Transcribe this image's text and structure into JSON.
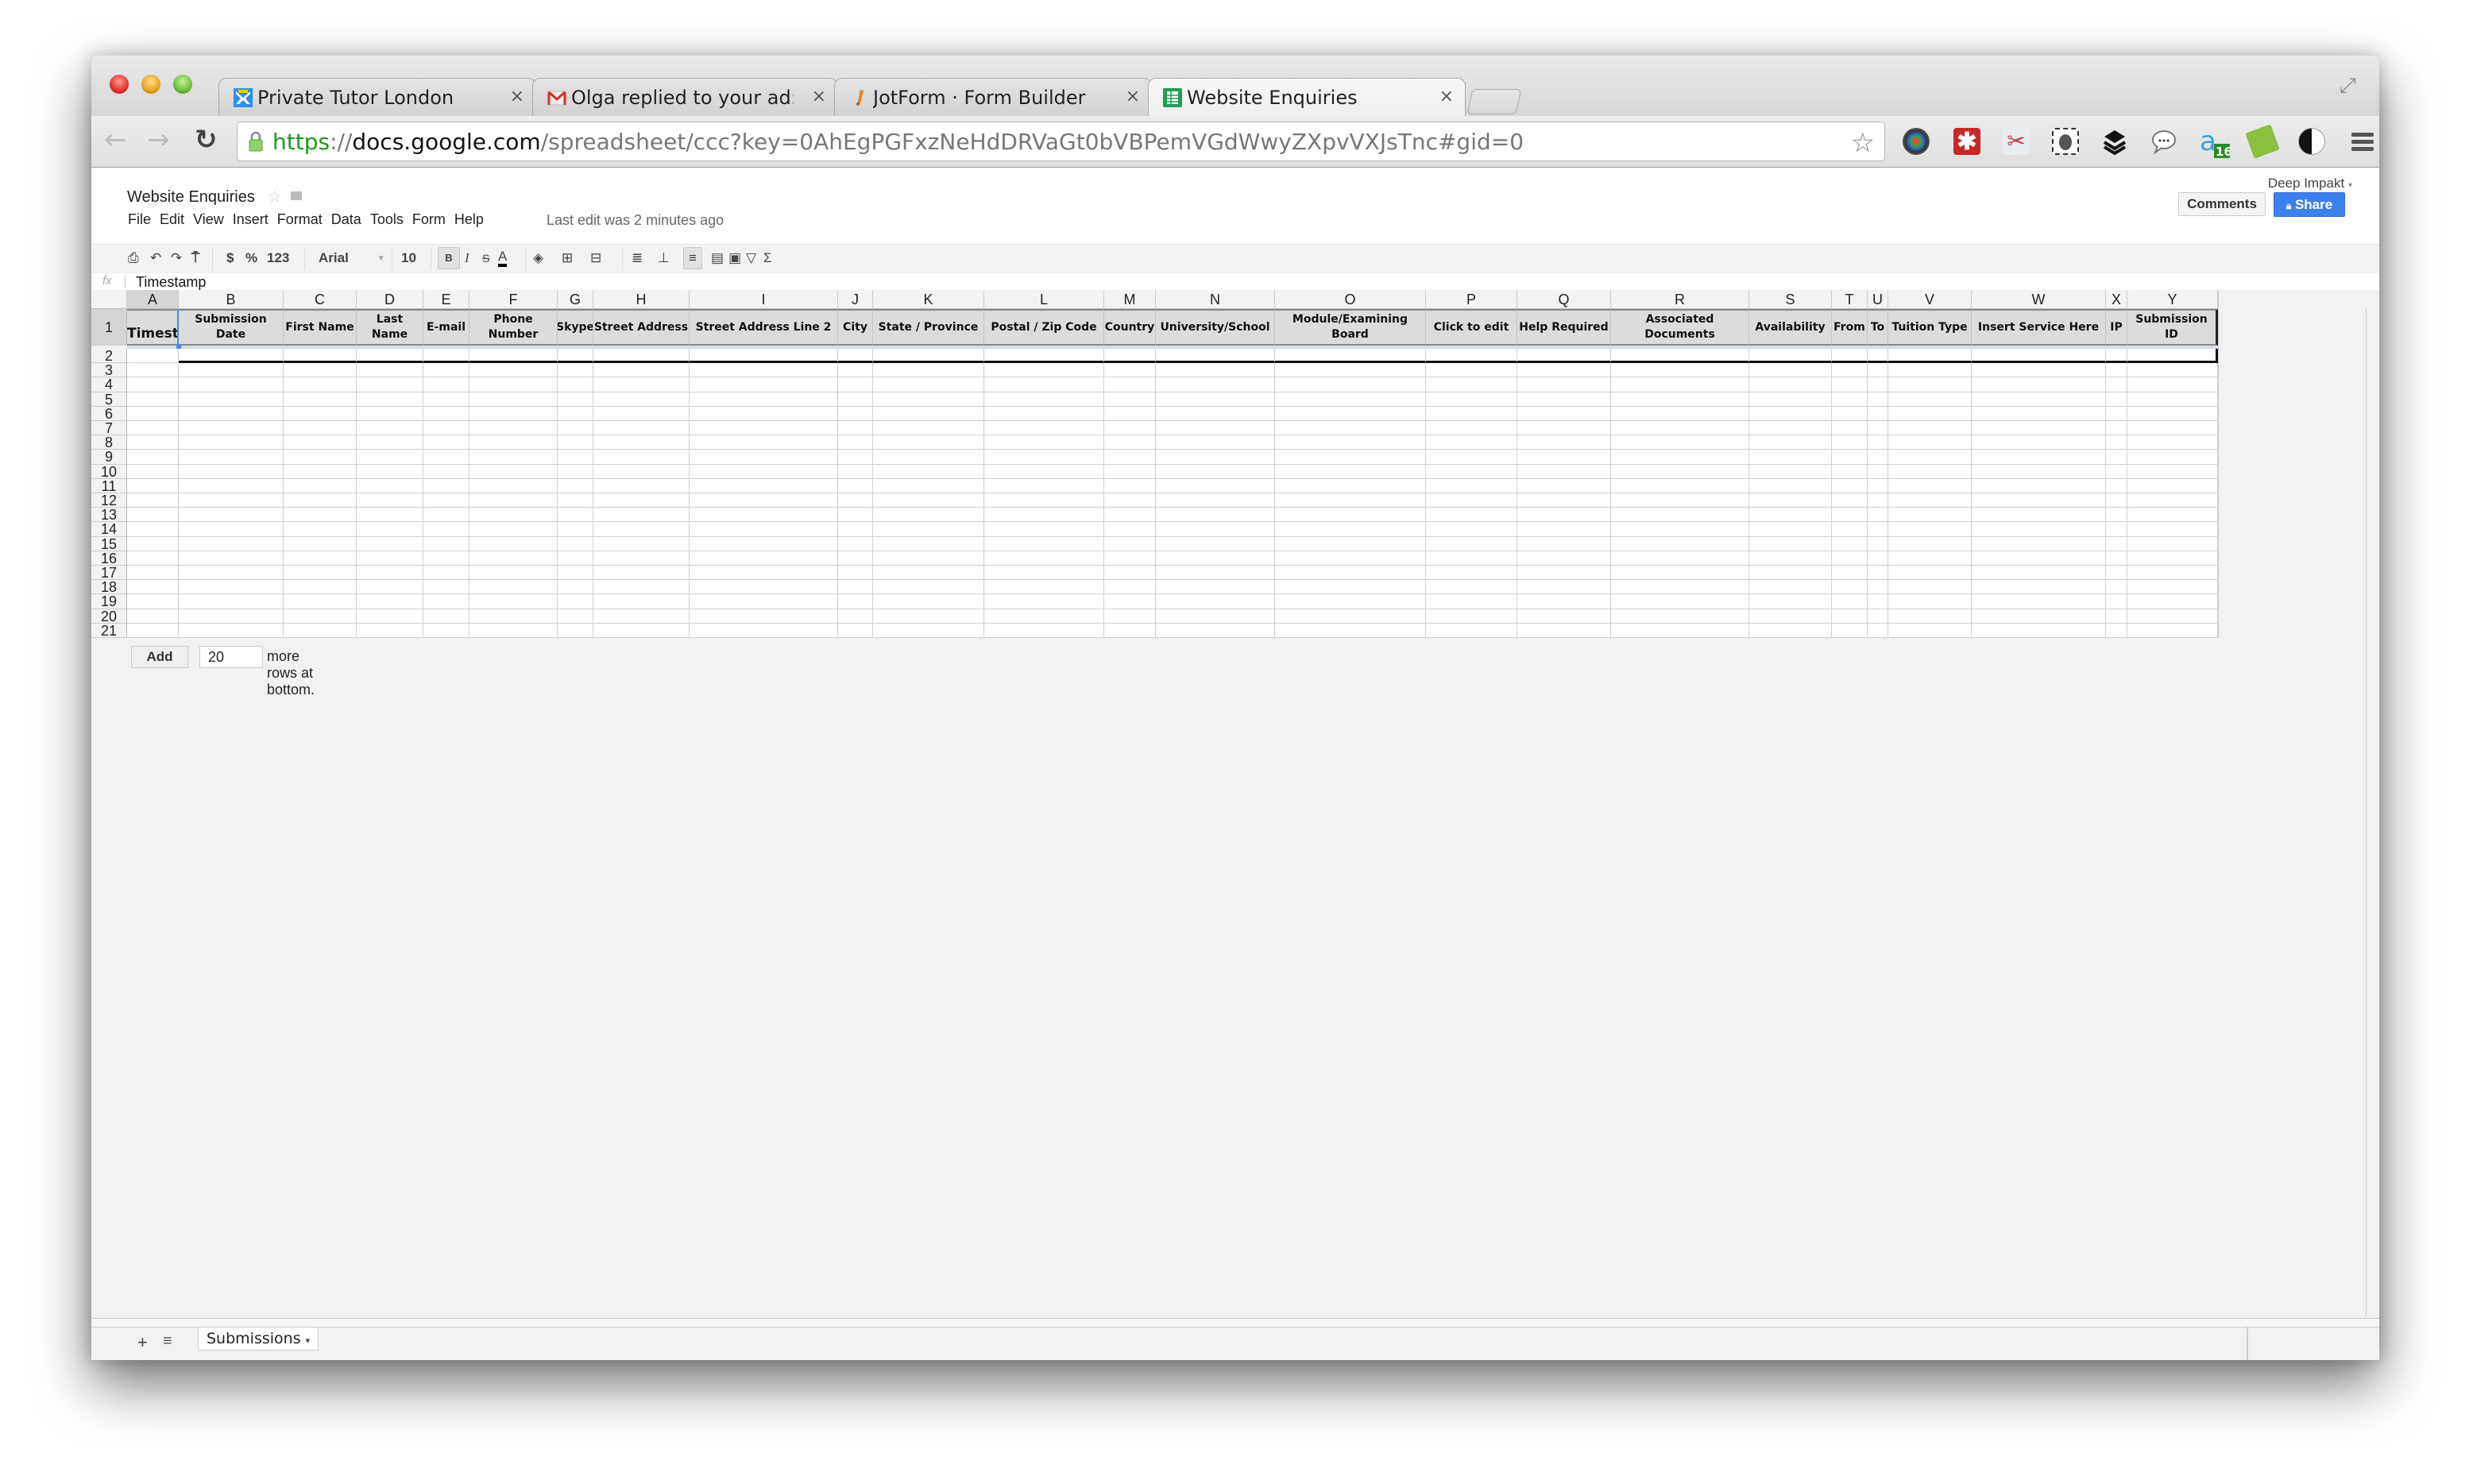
{
  "browser": {
    "tabs": [
      {
        "title": "Private Tutor London",
        "icon": "private-tutor-favicon",
        "active": false
      },
      {
        "title": "Olga replied to your ad: La",
        "icon": "gmail-favicon",
        "active": false
      },
      {
        "title": "JotForm · Form Builder",
        "icon": "jotform-favicon",
        "active": false
      },
      {
        "title": "Website Enquiries",
        "icon": "google-sheets-favicon",
        "active": true
      }
    ],
    "tab_close_glyph": "×",
    "url": {
      "scheme": "https",
      "separator": "://",
      "host": "docs.google.com",
      "path": "/spreadsheet/ccc?key=0AhEgPGFxzNeHdDRVaGt0bVBPemVGdWwyZXpvVXJsTnc#gid=0"
    },
    "extensions": [
      "camera-extension-icon",
      "lastpass-icon",
      "clipper-icon",
      "evernote-icon",
      "buffer-icon",
      "chat-bubble-icon",
      "a-extension-icon",
      "tag-extension-icon",
      "contrast-icon"
    ],
    "extension_badge": "16"
  },
  "doc": {
    "title": "Website Enquiries",
    "menu": [
      "File",
      "Edit",
      "View",
      "Insert",
      "Format",
      "Data",
      "Tools",
      "Form",
      "Help"
    ],
    "last_edit": "Last edit was 2 minutes ago",
    "user": "Deep Impakt",
    "user_caret": "▾",
    "comments_label": "Comments",
    "share_label": "Share",
    "toolbar": {
      "currency": "$",
      "percent": "%",
      "number_format": "123",
      "font": "Arial",
      "font_size": "10",
      "bold": "B",
      "italic": "I",
      "strike": "S",
      "text_color": "A",
      "sum": "Σ"
    },
    "formula_label": "fx",
    "formula_value": "Timestamp"
  },
  "sheet": {
    "columns": [
      "A",
      "B",
      "C",
      "D",
      "E",
      "F",
      "G",
      "H",
      "I",
      "J",
      "K",
      "L",
      "M",
      "N",
      "O",
      "P",
      "Q",
      "R",
      "S",
      "T",
      "U",
      "V",
      "W",
      "X",
      "Y"
    ],
    "headers": [
      "Timestamp",
      "Submission Date",
      "First Name",
      "Last Name",
      "E-mail",
      "Phone Number",
      "Skype",
      "Street Address",
      "Street Address Line 2",
      "City",
      "State / Province",
      "Postal / Zip Code",
      "Country",
      "University/School",
      "Module/Examining Board",
      "Click to edit",
      "Help Required",
      "Associated Documents",
      "Availability",
      "From",
      "To",
      "Tuition Type",
      "Insert Service Here",
      "IP",
      "Submission ID"
    ],
    "header_display": {
      "0": "Timesta"
    },
    "row_numbers": [
      "1",
      "2",
      "3",
      "4",
      "5",
      "6",
      "7",
      "8",
      "9",
      "10",
      "11",
      "12",
      "13",
      "14",
      "15",
      "16",
      "17",
      "18",
      "19",
      "20",
      "21"
    ],
    "selected_cell": "A1",
    "add_label": "Add",
    "add_count": "20",
    "add_suffix": "more rows at bottom.",
    "sheet_tabs": [
      {
        "name": "Submissions",
        "active": true
      }
    ],
    "add_sheet_glyph": "+",
    "sheet_list_glyph": "≡",
    "sheet_tab_caret": "▾"
  }
}
